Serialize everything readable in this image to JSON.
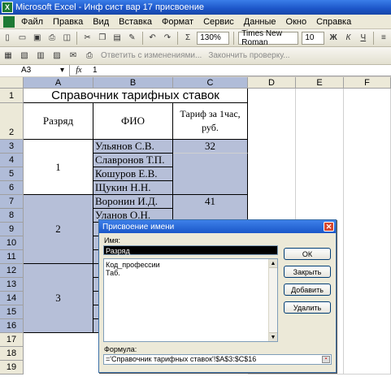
{
  "window": {
    "title": "Microsoft Excel - Инф сист вар 17 присвоение",
    "app_icon": "X"
  },
  "menu": [
    "Файл",
    "Правка",
    "Вид",
    "Вставка",
    "Формат",
    "Сервис",
    "Данные",
    "Окно",
    "Справка"
  ],
  "toolbar1": {
    "zoom": "130%",
    "font_name": "Times New Roman",
    "font_size": "10",
    "bold": "Ж",
    "italic": "К",
    "underline": "Ч",
    "sum": "Σ"
  },
  "toolbar2": {
    "reply": "Ответить с изменениями...",
    "end_review": "Закончить проверку..."
  },
  "formula_bar": {
    "name_box": "A3",
    "fx": "fx",
    "value": "1"
  },
  "columns": [
    "A",
    "B",
    "C",
    "D",
    "E",
    "F"
  ],
  "rows": [
    "1",
    "2",
    "3",
    "4",
    "5",
    "6",
    "7",
    "8",
    "9",
    "10",
    "11",
    "12",
    "13",
    "14",
    "15",
    "16",
    "17",
    "18",
    "19"
  ],
  "sheet": {
    "title": "Справочник тарифных ставок",
    "headers": [
      "Разряд",
      "ФИО",
      "Тариф за 1час, руб."
    ],
    "groups": [
      {
        "rank": "1",
        "rate": "32",
        "names": [
          "Ульянов С.В.",
          "Славронов Т.П.",
          "Кошуров Е.В.",
          "Щукин Н.Н."
        ]
      },
      {
        "rank": "2",
        "rate": "41",
        "names": [
          "Воронин И.Д.",
          "Уланов О.Н."
        ]
      },
      {
        "rank": "3",
        "rate": "",
        "names": []
      }
    ]
  },
  "dialog": {
    "title": "Присвоение имени",
    "name_label": "Имя:",
    "name_value": "Разряд",
    "list_items": [
      "Код_профессии",
      "Таб."
    ],
    "buttons": {
      "ok": "ОК",
      "close": "Закрыть",
      "add": "Добавить",
      "delete": "Удалить"
    },
    "formula_label": "Формула:",
    "formula_value": "='Справочник тарифных ставок'!$A$3:$C$16"
  }
}
